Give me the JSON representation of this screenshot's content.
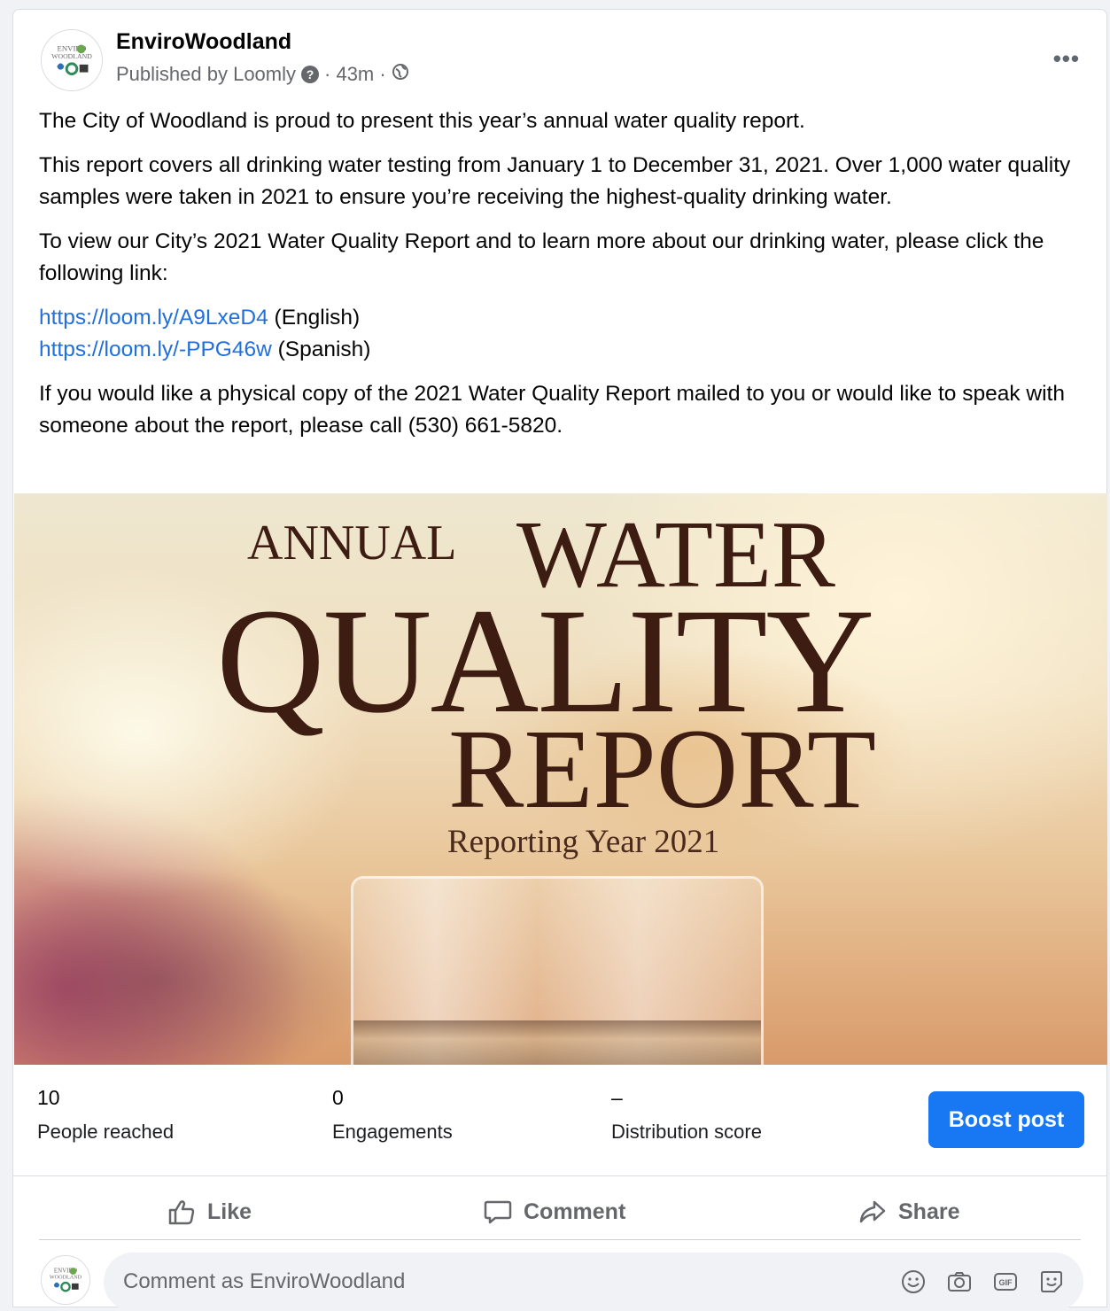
{
  "post": {
    "page_name": "EnviroWoodland",
    "published_by": "Published by Loomly",
    "help_glyph": "?",
    "time": "· 43m ·",
    "more_label": "•••",
    "logo_text_line1": "ENVIRO",
    "logo_text_line2": "WOODLAND",
    "paragraphs": [
      "The City of Woodland is proud to present this year’s annual water quality report.",
      "This report covers all drinking water testing from January 1 to December 31, 2021. Over 1,000 water quality samples were taken in 2021 to ensure you’re receiving the highest-quality drinking water.",
      "To view our City’s 2021 Water Quality Report and to learn more about our drinking water, please click the following link:",
      "If you would like a physical copy of the 2021 Water Quality Report mailed to you or would like to speak with someone about the report, please call (530) 661-5820."
    ],
    "links": [
      {
        "url": "https://loom.ly/A9LxeD4",
        "suffix": " (English)"
      },
      {
        "url": "https://loom.ly/-PPG46w",
        "suffix": " (Spanish)"
      }
    ]
  },
  "image": {
    "annual": "ANNUAL",
    "water": "WATER",
    "quality": "QUALITY",
    "report": "REPORT",
    "year": "Reporting Year 2021"
  },
  "stats": {
    "reached_value": "10",
    "reached_label": "People reached",
    "engagements_value": "0",
    "engagements_label": "Engagements",
    "distribution_value": "–",
    "distribution_label": "Distribution score",
    "boost_label": "Boost post"
  },
  "actions": {
    "like": "Like",
    "comment": "Comment",
    "share": "Share"
  },
  "comment": {
    "placeholder": "Comment as EnviroWoodland"
  },
  "colors": {
    "brand_blue": "#1877f2",
    "link_blue": "#216fdb",
    "title_brown": "#3d1c12"
  }
}
